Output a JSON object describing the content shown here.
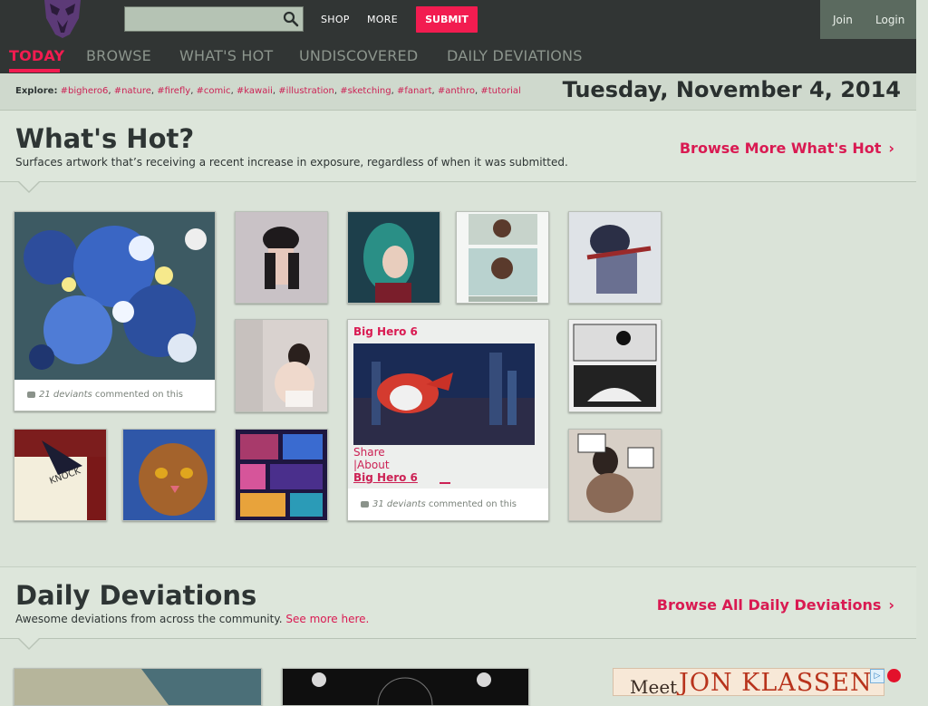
{
  "header": {
    "nav": {
      "shop": "SHOP",
      "more": "MORE",
      "submit": "SUBMIT"
    },
    "auth": {
      "join": "Join",
      "login": "Login"
    },
    "tabs": [
      "TODAY",
      "BROWSE",
      "WHAT'S HOT",
      "UNDISCOVERED",
      "DAILY DEVIATIONS"
    ]
  },
  "explore": {
    "label": "Explore:",
    "tags": [
      "#bighero6",
      "#nature",
      "#firefly",
      "#comic",
      "#kawaii",
      "#illustration",
      "#sketching",
      "#fanart",
      "#anthro",
      "#tutorial"
    ]
  },
  "date": "Tuesday, November 4, 2014",
  "whats_hot": {
    "title": "What's Hot?",
    "subtitle": "Surfaces artwork that’s receiving a recent increase in exposure, regardless of when it was submitted.",
    "more": "Browse More What's Hot",
    "big_tile": {
      "count": "21 deviants",
      "suffix": "commented on this"
    },
    "feature": {
      "title": "Big Hero 6",
      "share": "Share",
      "about": "|About",
      "link": "Big Hero 6",
      "count": "31 deviants",
      "suffix": "commented on this"
    }
  },
  "daily": {
    "title": "Daily Deviations",
    "subtitle": "Awesome deviations from across the community.",
    "see_more": "See more here.",
    "more": "Browse All Daily Deviations"
  },
  "ad": {
    "meet": "Meet",
    "name": "JON KLASSEN",
    "choice": "▷"
  },
  "colors": {
    "accent": "#f21c50",
    "link": "#d91a52",
    "bg": "#dae3d8",
    "topbar": "#313534"
  }
}
